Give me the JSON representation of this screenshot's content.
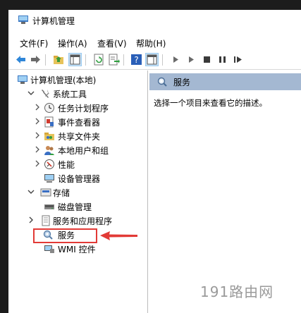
{
  "window": {
    "title": "计算机管理"
  },
  "menu": [
    {
      "id": "file",
      "label": "文件(F)"
    },
    {
      "id": "action",
      "label": "操作(A)"
    },
    {
      "id": "view",
      "label": "查看(V)"
    },
    {
      "id": "help",
      "label": "帮助(H)"
    }
  ],
  "toolbar": {
    "items": [
      "back-arrow-icon",
      "forward-arrow-icon",
      "up-folder-icon",
      "show-hide-tree-icon",
      "refresh-icon",
      "export-list-icon",
      "help-icon",
      "properties-icon",
      "play-icon",
      "play-alt-icon",
      "stop-icon",
      "pause-icon",
      "restart-icon"
    ]
  },
  "tree": {
    "root": "计算机管理(本地)",
    "system_tools": "系统工具",
    "task_scheduler": "任务计划程序",
    "event_viewer": "事件查看器",
    "shared_folders": "共享文件夹",
    "local_users": "本地用户和组",
    "performance": "性能",
    "device_manager": "设备管理器",
    "storage": "存储",
    "disk_management": "磁盘管理",
    "services_apps": "服务和应用程序",
    "services": "服务",
    "wmi": "WMI 控件"
  },
  "right_pane": {
    "header": "服务",
    "description": "选择一个项目来查看它的描述。"
  },
  "watermark": "191路由网",
  "colors": {
    "highlight_box": "#e23a36",
    "pane_header": "#a4b8d2",
    "selection": "#cce4f7"
  }
}
